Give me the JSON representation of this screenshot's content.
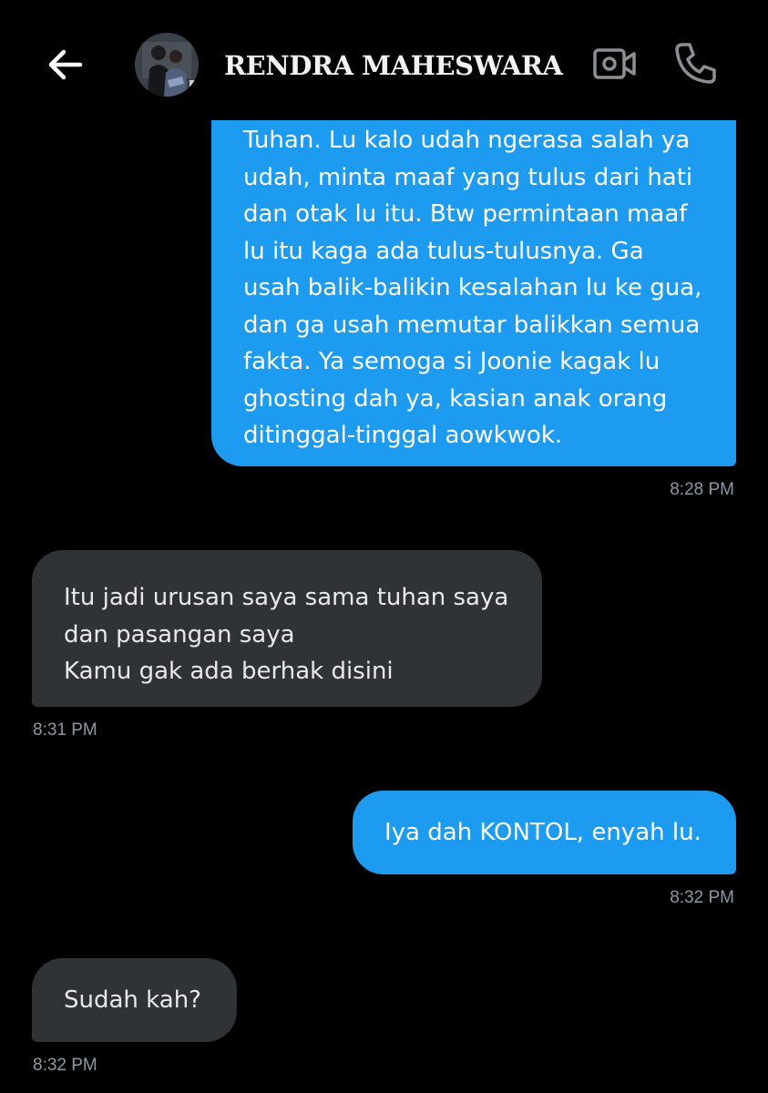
{
  "header": {
    "back_icon": "arrow-left-icon",
    "contact_name": "RENDRA MAHESWARA",
    "video_icon": "video-camera-icon",
    "call_icon": "phone-icon"
  },
  "colors": {
    "background": "#000000",
    "outgoing_bubble": "#1d9bf0",
    "incoming_bubble": "#2f3336",
    "timestamp": "#8b98a5"
  },
  "messages": [
    {
      "direction": "outgoing",
      "lines": [
        "Tuhan. Lu kalo udah ngerasa salah ya",
        "udah, minta maaf yang tulus dari hati",
        "dan otak lu itu. Btw permintaan maaf",
        "lu itu kaga ada tulus-tulusnya. Ga",
        "usah balik-balikin kesalahan lu ke gua,",
        "dan ga usah memutar balikkan semua",
        "fakta. Ya semoga si Joonie kagak lu",
        "ghosting dah ya, kasian anak orang",
        "ditinggal-tinggal aowkwok."
      ],
      "time": "8:28 PM"
    },
    {
      "direction": "incoming",
      "lines": [
        "Itu jadi urusan saya sama tuhan saya",
        "dan pasangan saya",
        "Kamu gak ada berhak disini"
      ],
      "time": "8:31 PM"
    },
    {
      "direction": "outgoing",
      "lines": [
        "Iya dah KONTOL, enyah lu."
      ],
      "time": "8:32 PM"
    },
    {
      "direction": "incoming",
      "lines": [
        "Sudah kah?"
      ],
      "time": "8:32 PM"
    }
  ]
}
